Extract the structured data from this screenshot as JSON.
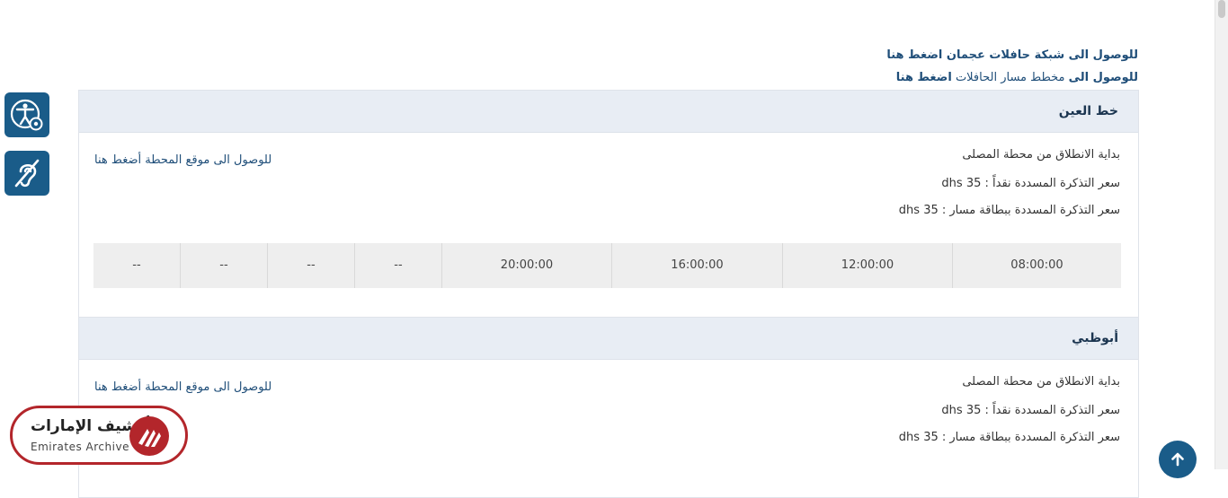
{
  "links": {
    "ajman_network": "للوصول الى شبكة حافلات عجمان اضغط هنا",
    "route_map_prefix": "للوصول الى",
    "route_map_middle": "مخطط مسار الحافلات",
    "route_map_action": "اضغط هنا"
  },
  "accessibility": {
    "icon1": "accessibility-settings-icon",
    "icon2": "hearing-impaired-icon"
  },
  "routes": [
    {
      "title": "خط العين",
      "start": "بداية الانطلاق من محطة المصلى",
      "price_cash": "سعر التذكرة المسددة نقداً : 35 dhs",
      "price_card": "سعر التذكرة المسددة ببطاقة مسار : 35 dhs",
      "station_link": "للوصول الى موقع المحطة أضغط هنا",
      "times": [
        "08:00:00",
        "12:00:00",
        "16:00:00",
        "20:00:00",
        "--",
        "--",
        "--",
        "--"
      ]
    },
    {
      "title": "أبوظبي",
      "start": "بداية الانطلاق من محطة المصلى",
      "price_cash": "سعر التذكرة المسددة نقداً : 35 dhs",
      "price_card": "سعر التذكرة المسددة ببطاقة مسار : 35 dhs",
      "station_link": "للوصول الى موقع المحطة أضغط هنا"
    }
  ],
  "logo": {
    "arabic": "أرشيف الإمارات",
    "english": "Emirates Archive"
  },
  "colors": {
    "accent": "#1a5c89",
    "link": "#1f4e79",
    "logo_red": "#b3262b"
  }
}
